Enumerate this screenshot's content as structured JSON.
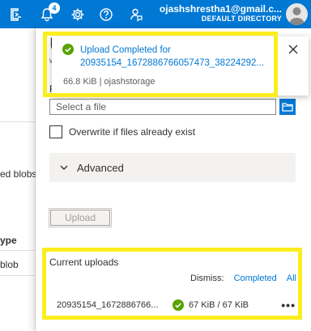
{
  "topbar": {
    "icons": [
      "cloud-shell-icon",
      "notifications-icon",
      "settings-icon",
      "help-icon",
      "feedback-icon"
    ],
    "notification_count": "4",
    "account_email": "ojashshrestha1@gmail.c...",
    "account_directory": "DEFAULT DIRECTORY"
  },
  "left_panel": {
    "text1": "ed blobs",
    "text2": "ype",
    "text3": "blob"
  },
  "blade": {
    "title_fragment": "U",
    "subtitle_fragment": "w",
    "files_label_fragment": "Fi",
    "file_input_placeholder": "Select a file",
    "overwrite_label": "Overwrite if files already exist",
    "advanced_label": "Advanced",
    "upload_button": "Upload"
  },
  "notification": {
    "title_line1": "Upload Completed for",
    "title_line2": "20935154_1672886766057473_38224292...",
    "subtitle": "66.8 KiB | ojashstorage"
  },
  "current_uploads": {
    "title": "Current uploads",
    "dismiss_label": "Dismiss:",
    "dismiss_completed": "Completed",
    "dismiss_all": "All",
    "items": [
      {
        "name": "20935154_1672886766...",
        "progress": "67 KiB / 67 KiB",
        "more": "•••"
      }
    ]
  },
  "colors": {
    "accent": "#0078d4",
    "success": "#57a300",
    "highlight": "#fbee1e"
  }
}
